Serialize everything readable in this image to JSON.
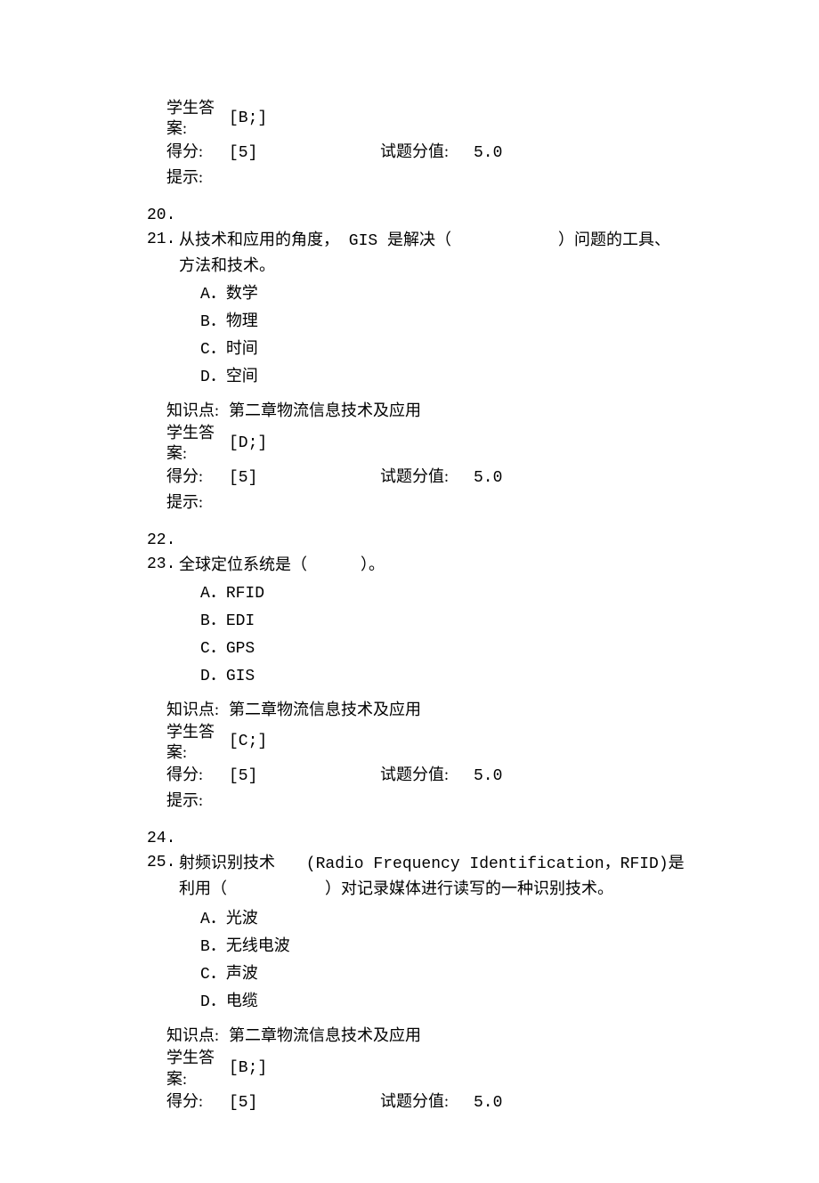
{
  "labels": {
    "studentAnswer": "学生答案:",
    "score": "得分:",
    "pointsLabel": "试题分值:",
    "hint": "提示:",
    "knowledge": "知识点:"
  },
  "q19meta": {
    "answer": "[B;]",
    "score": "[5]",
    "points": "5.0"
  },
  "q20num": "20.",
  "q21": {
    "num": "21.",
    "text_a": "从技术和应用的角度，",
    "text_b": " GIS 是解决（",
    "text_c": "）问题的工具、方法和技术。",
    "options": {
      "A": "数学",
      "B": "物理",
      "C": "时间",
      "D": "空间"
    },
    "knowledge": "第二章物流信息技术及应用",
    "answer": "[D;]",
    "score": "[5]",
    "points": "5.0"
  },
  "q22num": "22.",
  "q23": {
    "num": "23.",
    "text": "全球定位系统是（",
    "text_b": "）。",
    "options": {
      "A": "RFID",
      "B": "EDI",
      "C": "GPS",
      "D": "GIS"
    },
    "knowledge": "第二章物流信息技术及应用",
    "answer": "[C;]",
    "score": "[5]",
    "points": "5.0"
  },
  "q24num": "24.",
  "q25": {
    "num": "25.",
    "text_a": "射频识别技术",
    "text_b": " (Radio Frequency Identification，RFID)是利用（",
    "text_c": "）对记录媒体进行读写的一种识别技术。",
    "options": {
      "A": "光波",
      "B": "无线电波",
      "C": "声波",
      "D": "电缆"
    },
    "knowledge": "第二章物流信息技术及应用",
    "answer": "[B;]",
    "score": "[5]",
    "points": "5.0"
  }
}
